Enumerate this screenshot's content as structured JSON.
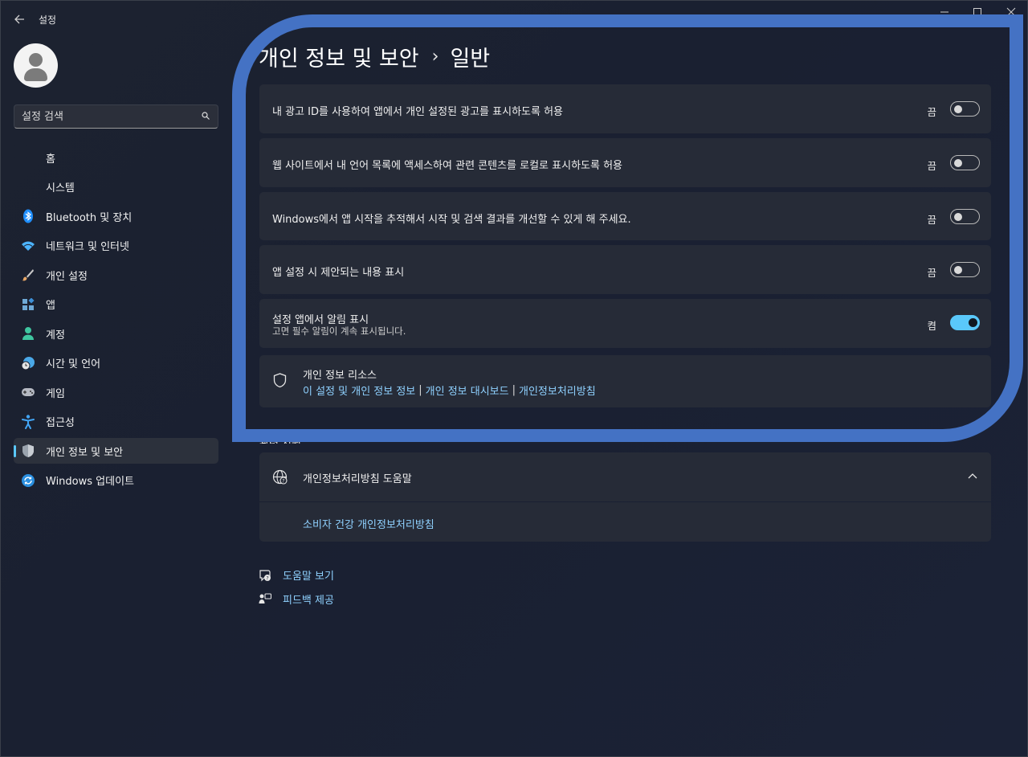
{
  "window": {
    "title": "설정",
    "controls": [
      "minimize-icon",
      "maximize-icon",
      "close-icon"
    ]
  },
  "search": {
    "placeholder": "설정 검색"
  },
  "sidebar": {
    "items": [
      {
        "label": "홈",
        "icon": "home-icon"
      },
      {
        "label": "시스템",
        "icon": "system-icon"
      },
      {
        "label": "Bluetooth 및 장치",
        "icon": "bluetooth-icon",
        "color": "#1f8fff"
      },
      {
        "label": "네트워크 및 인터넷",
        "icon": "wifi-icon",
        "color": "#4cb4ff"
      },
      {
        "label": "개인 설정",
        "icon": "brush-icon",
        "color": "#e8a766"
      },
      {
        "label": "앱",
        "icon": "apps-icon",
        "color": "#6fa9d6"
      },
      {
        "label": "계정",
        "icon": "account-icon",
        "color": "#3fc6a0"
      },
      {
        "label": "시간 및 언어",
        "icon": "globe-clock-icon",
        "color": "#4aa8e8"
      },
      {
        "label": "게임",
        "icon": "gamepad-icon",
        "color": "#b5b9c2"
      },
      {
        "label": "접근성",
        "icon": "accessibility-icon",
        "color": "#42a5f5"
      },
      {
        "label": "개인 정보 및 보안",
        "icon": "shield-icon",
        "color": "#9aa3ad",
        "active": true
      },
      {
        "label": "Windows 업데이트",
        "icon": "update-icon",
        "color": "#2a8fe0"
      }
    ]
  },
  "breadcrumb": {
    "parent": "개인 정보 및 보안",
    "separator": "›",
    "current": "일반"
  },
  "settings": [
    {
      "label": "내 광고 ID를 사용하여 앱에서 개인 설정된 광고를 표시하도록 허용",
      "state": "끔",
      "on": false
    },
    {
      "label": "웹 사이트에서 내 언어 목록에 액세스하여 관련 콘텐츠를 로컬로 표시하도록 허용",
      "state": "끔",
      "on": false
    },
    {
      "label": "Windows에서 앱 시작을 추적해서 시작 및 검색 결과를 개선할 수 있게 해 주세요.",
      "state": "끔",
      "on": false
    },
    {
      "label": "앱 설정 시 제안되는 내용 표시",
      "state": "끔",
      "on": false
    },
    {
      "label": "설정 앱에서 알림 표시",
      "sublabel": "고면 필수 알림이 계속 표시됩니다.",
      "state": "켬",
      "on": true
    }
  ],
  "privacy_resources": {
    "title": "개인 정보 리소스",
    "links": [
      "이 설정 및 개인 정보 정보",
      "개인 정보 대시보드",
      "개인정보처리방침"
    ],
    "separator": "|"
  },
  "related_section_partial": "관련 지원",
  "help_expander": {
    "title": "개인정보처리방침 도움말",
    "link": "소비자 건강 개인정보처리방침"
  },
  "footer_links": {
    "help": "도움말 보기",
    "feedback": "피드백 제공"
  },
  "colors": {
    "accent": "#5ac8fa",
    "overlay_frame": "#4472c4",
    "link": "#8fd1ff"
  }
}
